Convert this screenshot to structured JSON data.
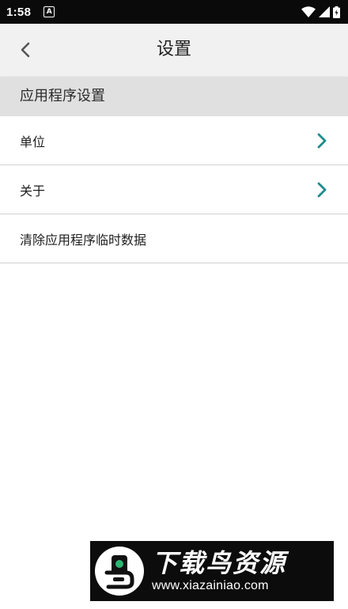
{
  "status_bar": {
    "time": "1:58",
    "notification_glyph": "A"
  },
  "app_bar": {
    "title": "设置"
  },
  "section": {
    "label": "应用程序设置"
  },
  "items": [
    {
      "label": "单位",
      "has_chevron": true
    },
    {
      "label": "关于",
      "has_chevron": true
    },
    {
      "label": "清除应用程序临时数据",
      "has_chevron": false
    }
  ],
  "watermark": {
    "title": "下载鸟资源",
    "url": "www.xiazainiao.com"
  },
  "colors": {
    "status_bar": "#0a0a0a",
    "app_bar": "#f1f1f1",
    "section_header": "#e0e0e0",
    "chevron_accent": "#1e8c8c",
    "divider": "#d2d2d2",
    "logo_green": "#2ab673"
  }
}
